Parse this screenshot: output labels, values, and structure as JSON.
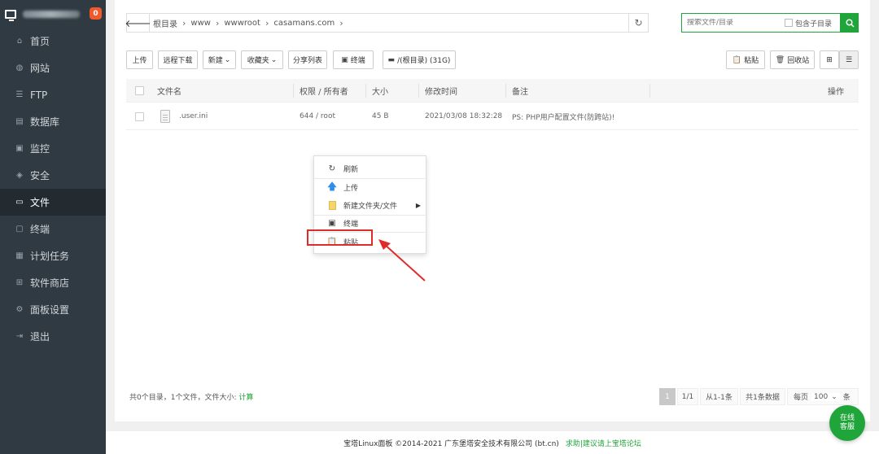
{
  "sidebar": {
    "badge": "0",
    "items": [
      {
        "label": "首页",
        "icon": "home-icon"
      },
      {
        "label": "网站",
        "icon": "globe-icon"
      },
      {
        "label": "FTP",
        "icon": "ftp-icon"
      },
      {
        "label": "数据库",
        "icon": "database-icon"
      },
      {
        "label": "监控",
        "icon": "monitor-icon"
      },
      {
        "label": "安全",
        "icon": "shield-icon"
      },
      {
        "label": "文件",
        "icon": "folder-icon"
      },
      {
        "label": "终端",
        "icon": "terminal-icon"
      },
      {
        "label": "计划任务",
        "icon": "calendar-icon"
      },
      {
        "label": "软件商店",
        "icon": "grid-icon"
      },
      {
        "label": "面板设置",
        "icon": "gear-icon"
      },
      {
        "label": "退出",
        "icon": "logout-icon"
      }
    ],
    "active_index": 6
  },
  "path": {
    "crumbs": [
      "根目录",
      "www",
      "wwwroot",
      "casamans.com"
    ]
  },
  "search": {
    "placeholder": "搜索文件/目录",
    "include_sub": "包含子目录"
  },
  "toolbar": {
    "upload": "上传",
    "remote_download": "远程下载",
    "new": "新建",
    "favorites": "收藏夹",
    "share_list": "分享列表",
    "terminal": "终端",
    "disk": "/(根目录) (31G)",
    "paste": "粘贴",
    "recycle": "回收站"
  },
  "table": {
    "headers": {
      "name": "文件名",
      "perm": "权限 / 所有者",
      "size": "大小",
      "mtime": "修改时间",
      "note": "备注",
      "ops": "操作"
    },
    "rows": [
      {
        "name": ".user.ini",
        "perm": "644 / root",
        "size": "45 B",
        "mtime": "2021/03/08 18:32:28",
        "note": "PS: PHP用户配置文件(防跨站)!"
      }
    ]
  },
  "context_menu": {
    "refresh": "刷新",
    "upload": "上传",
    "new": "新建文件夹/文件",
    "terminal": "终端",
    "paste": "粘贴"
  },
  "summary": {
    "text": "共0个目录，1个文件，文件大小: ",
    "calc": "计算"
  },
  "pager": {
    "current": "1",
    "pages": "1/1",
    "range": "从1-1条",
    "total": "共1条数据",
    "per_page_label": "每页",
    "per_page": "100",
    "unit": "条"
  },
  "footer": {
    "copyright": "宝塔Linux面板 ©2014-2021 广东堡塔安全技术有限公司 (bt.cn)",
    "link": "求助|建议请上宝塔论坛"
  },
  "chat": {
    "line1": "在线",
    "line2": "客服"
  },
  "colors": {
    "accent": "#20a53a",
    "sidebar": "#2f3a42",
    "highlight": "#e02b2b",
    "badge": "#f1582b"
  }
}
